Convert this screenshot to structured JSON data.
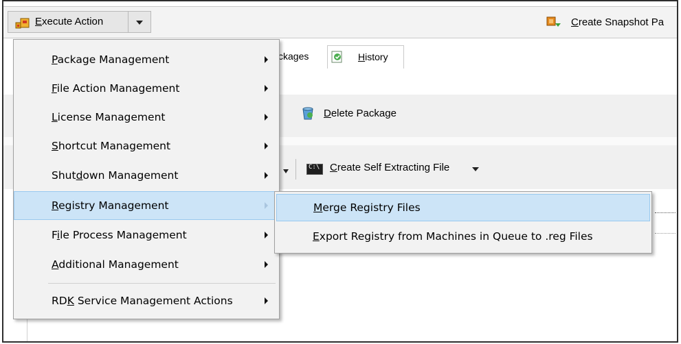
{
  "toolbar": {
    "execute_action_label": "Execute Action",
    "execute_action_underline": "E",
    "execute_action_rest": "xecute Action",
    "create_snapshot_label": "Create Snapshot Pa",
    "create_snapshot_underline": "C",
    "create_snapshot_rest": "reate Snapshot Pa"
  },
  "tabs": {
    "packages_partial": "ckages",
    "history_underline": "H",
    "history_rest": "istory"
  },
  "package_bar": {
    "delete_package_underline": "D",
    "delete_package_rest": "elete Package"
  },
  "file_bar": {
    "self_extract_underline": "C",
    "self_extract_rest": "reate Self Extracting File"
  },
  "menu": {
    "items": [
      {
        "pre": "",
        "u": "P",
        "post": "ackage Management",
        "has_submenu": true
      },
      {
        "pre": "",
        "u": "F",
        "post": "ile Action Management",
        "has_submenu": true
      },
      {
        "pre": "",
        "u": "L",
        "post": "icense Management",
        "has_submenu": true
      },
      {
        "pre": "",
        "u": "S",
        "post": "hortcut Management",
        "has_submenu": true
      },
      {
        "pre": "Shut",
        "u": "d",
        "post": "own Management",
        "has_submenu": true
      },
      {
        "pre": "",
        "u": "R",
        "post": "egistry Management",
        "has_submenu": true,
        "selected": true
      },
      {
        "pre": "F",
        "u": "i",
        "post": "le Process Management",
        "has_submenu": true
      },
      {
        "pre": "",
        "u": "A",
        "post": "dditional Management",
        "has_submenu": true
      },
      {
        "pre": "RD",
        "u": "K",
        "post": " Service Management Actions",
        "has_submenu": true
      }
    ]
  },
  "submenu": {
    "items": [
      {
        "pre": "",
        "u": "M",
        "post": "erge Registry Files",
        "selected": true
      },
      {
        "pre": "",
        "u": "E",
        "post": "xport Registry from Machines in Queue to .reg Files"
      }
    ]
  },
  "colors": {
    "highlight_bg": "#cce4f7",
    "highlight_border": "#99c9ef",
    "menu_bg": "#f2f2f2"
  }
}
